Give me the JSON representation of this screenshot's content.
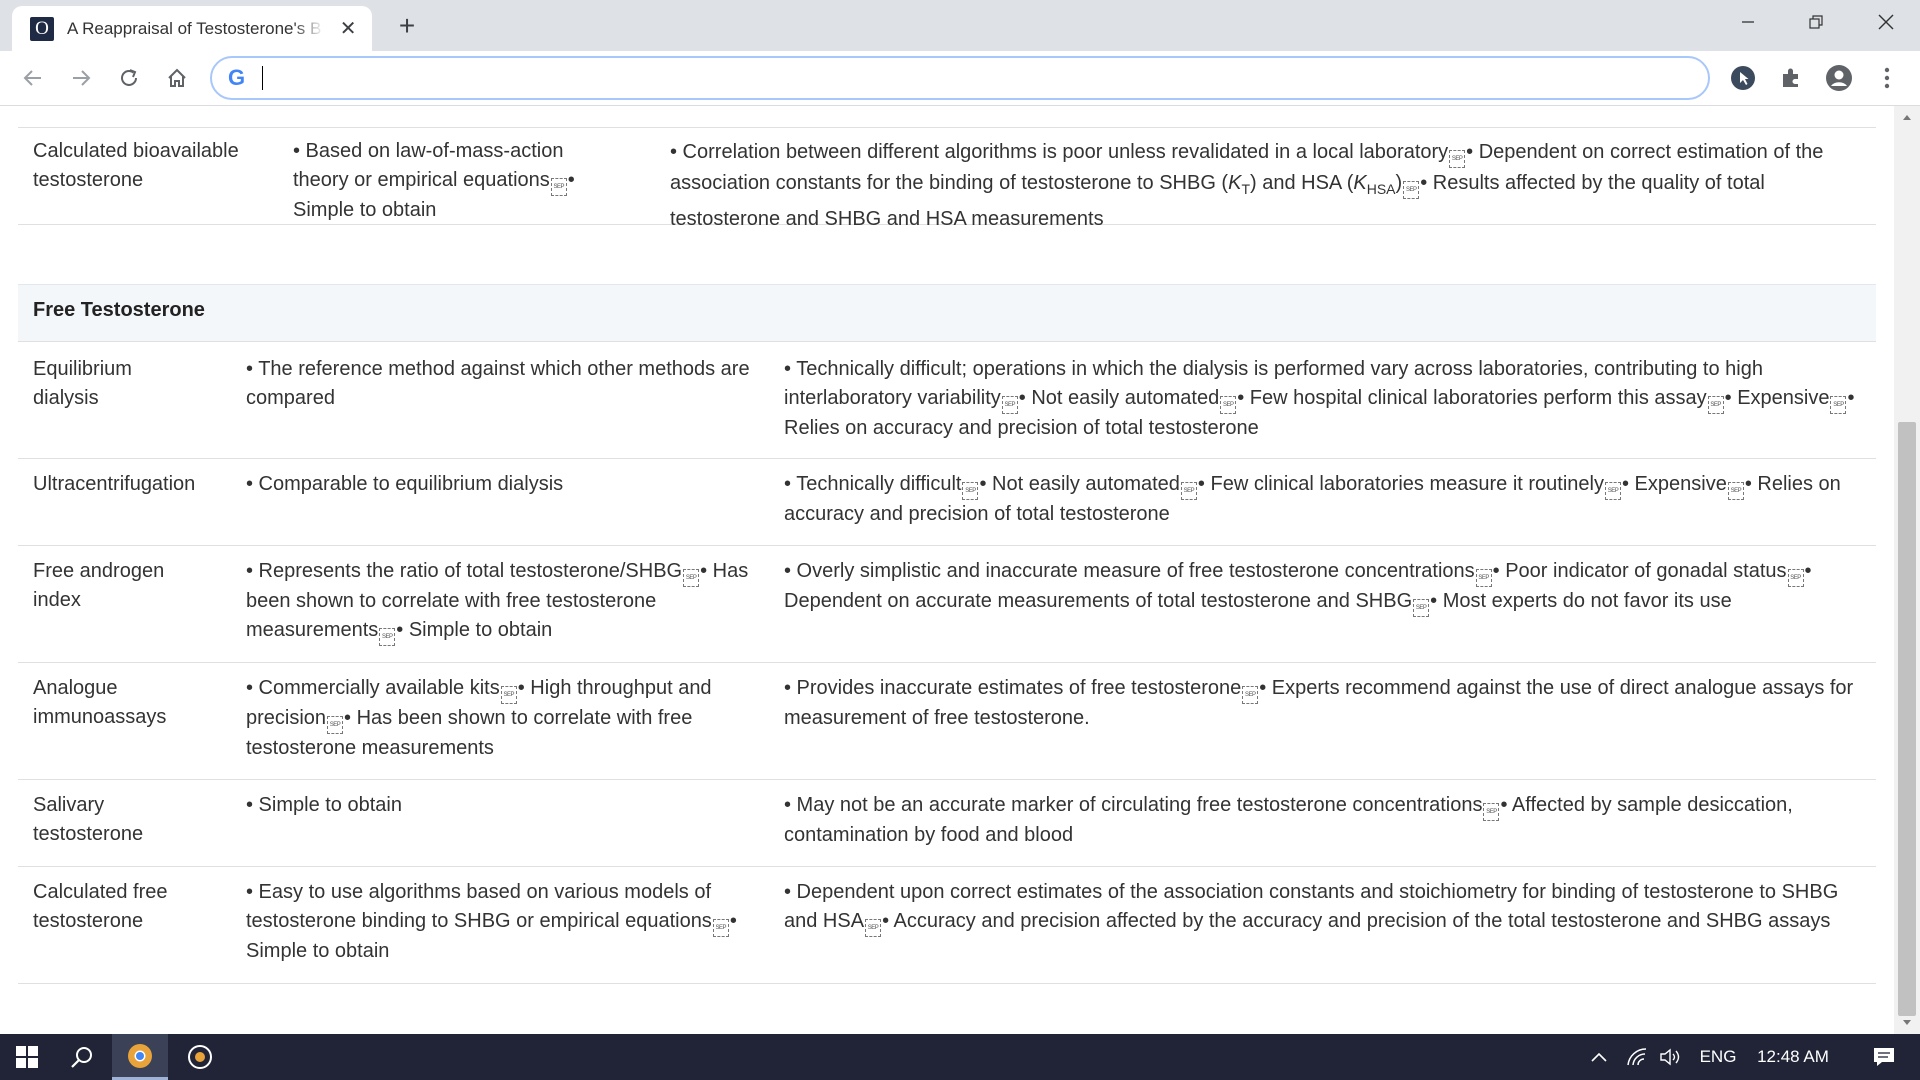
{
  "browser": {
    "tab_title": "A Reappraisal of Testosterone's B",
    "tab_favicon_letter": "O",
    "tab_close": "✕",
    "new_tab": "+",
    "window_controls": {
      "minimize": "—",
      "maximize": "❐",
      "close": "✕"
    },
    "address_value": "",
    "address_icon": "G"
  },
  "sep_label": "SEP",
  "rows_top": [
    {
      "method": "Calculated bioavailable testosterone",
      "advantages": [
        "• Based on law-of-mass-action theory or empirical equations",
        "• Simple to obtain"
      ],
      "disadvantages_part1": "• Correlation between different algorithms is poor unless revalidated in a local laboratory",
      "disadvantages_part2": "• Dependent on correct estimation of the association constants for the binding of testosterone to SHBG (",
      "kt": "K",
      "kt_sub": "T",
      "disadvantages_part3": ") and HSA (",
      "khsa": "K",
      "khsa_sub": "HSA",
      "disadvantages_part4": ")",
      "disadvantages_part5": "• Results affected by the quality of total testosterone and SHBG and HSA measurements"
    }
  ],
  "section": {
    "title": "Free Testosterone"
  },
  "rows": [
    {
      "method": "Equilibrium dialysis",
      "advantages": [
        "• The reference method against which other methods are compared"
      ],
      "disadvantages": [
        "• Technically difficult; operations in which the dialysis is performed vary across laboratories, contributing to high interlaboratory variability",
        "• Not easily automated",
        "• Few hospital clinical laboratories perform this assay",
        "• Expensive",
        "• Relies on accuracy and precision of total testosterone"
      ]
    },
    {
      "method": "Ultracentrifugation",
      "advantages": [
        "• Comparable to equilibrium dialysis"
      ],
      "disadvantages": [
        "• Technically difficult",
        "• Not easily automated",
        "• Few clinical laboratories measure it routinely",
        "• Expensive",
        "• Relies on accuracy and precision of total testosterone"
      ]
    },
    {
      "method": "Free androgen index",
      "advantages": [
        "• Represents the ratio of total testosterone/SHBG",
        "• Has been shown to correlate with free testosterone measurements",
        "• Simple to obtain"
      ],
      "disadvantages": [
        "• Overly simplistic and inaccurate measure of free testosterone concentrations",
        "• Poor indicator of gonadal status",
        "• Dependent on accurate measurements of total testosterone and SHBG",
        "• Most experts do not favor its use"
      ]
    },
    {
      "method": "Analogue immunoassays",
      "advantages": [
        "• Commercially available kits",
        "• High throughput and precision",
        "• Has been shown to correlate with free testosterone measurements"
      ],
      "disadvantages": [
        "• Provides inaccurate estimates of free testosterone",
        "• Experts recommend against the use of direct analogue assays for measurement of free testosterone."
      ]
    },
    {
      "method": "Salivary testosterone",
      "advantages": [
        "• Simple to obtain"
      ],
      "disadvantages": [
        "• May not be an accurate marker of circulating free testosterone concentrations",
        "• Affected by sample desiccation, contamination by food and blood"
      ]
    },
    {
      "method": "Calculated free testosterone",
      "advantages": [
        "• Easy to use algorithms based on various models of testosterone binding to SHBG or empirical equations",
        "• Simple to obtain"
      ],
      "disadvantages": [
        "• Dependent upon correct estimates of the association constants and stoichiometry for binding of testosterone to SHBG and HSA",
        "• Accuracy and precision affected by the accuracy and precision of the total testosterone and SHBG assays"
      ]
    }
  ],
  "taskbar": {
    "language": "ENG",
    "time": "12:48 AM"
  },
  "colors": {
    "taskbar_bg": "#202436",
    "titlebar_bg": "#dee1e6",
    "section_bg": "#f4f7f9"
  }
}
